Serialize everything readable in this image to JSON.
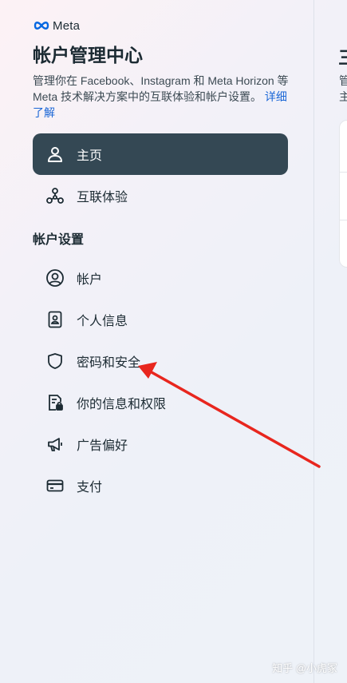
{
  "logo": {
    "text": "Meta",
    "icon": "meta-logo-icon"
  },
  "title": "帐户管理中心",
  "description": {
    "text": "管理你在 Facebook、Instagram 和 Meta Horizon 等 Meta 技术解决方案中的互联体验和帐户设置。",
    "link": "详细了解"
  },
  "nav": {
    "home": {
      "label": "主页",
      "icon": "person-icon"
    },
    "connected": {
      "label": "互联体验",
      "icon": "connected-nodes-icon"
    }
  },
  "settings": {
    "title": "帐户设置",
    "items": [
      {
        "label": "帐户",
        "icon": "user-circle-icon"
      },
      {
        "label": "个人信息",
        "icon": "id-card-icon"
      },
      {
        "label": "密码和安全",
        "icon": "shield-icon"
      },
      {
        "label": "你的信息和权限",
        "icon": "document-lock-icon"
      },
      {
        "label": "广告偏好",
        "icon": "megaphone-icon"
      },
      {
        "label": "支付",
        "icon": "credit-card-icon"
      }
    ]
  },
  "right_panel": {
    "title_fragment": "三",
    "desc_line1": "管",
    "desc_line2": "主"
  },
  "annotation": {
    "color": "#e8261e"
  },
  "watermark": "知乎 @小虎冢",
  "colors": {
    "active_bg": "#344854",
    "link": "#1a66d6",
    "text": "#1c2b33"
  }
}
